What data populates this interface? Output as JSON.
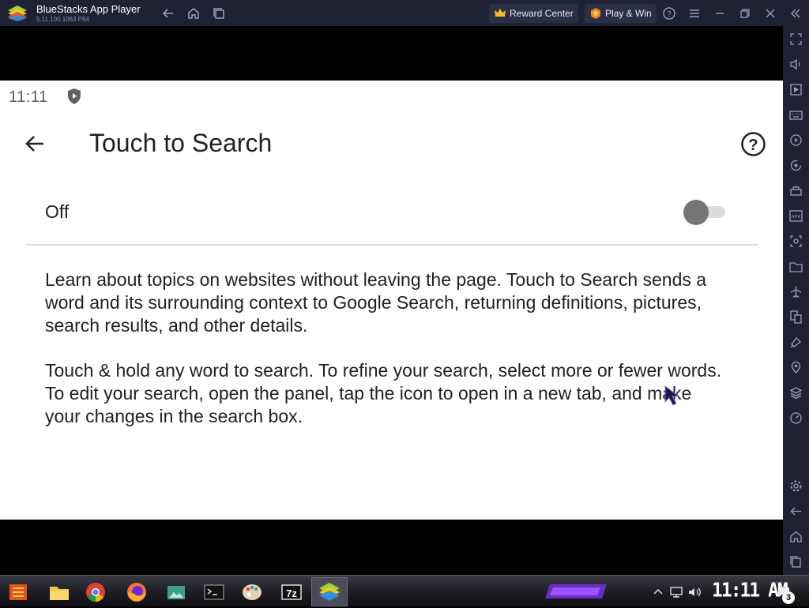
{
  "window": {
    "app_title": "BlueStacks App Player",
    "version": "5.11.100.1063 P64",
    "reward_center_label": "Reward Center",
    "play_win_label": "Play & Win"
  },
  "status_bar": {
    "time": "11:11"
  },
  "settings_page": {
    "title": "Touch to Search",
    "toggle_label": "Off",
    "toggle_on": false,
    "description_1": "Learn about topics on websites without leaving the page. Touch to Search sends a word and its surrounding context to Google Search, returning definitions, pictures, search results, and other details.",
    "description_2": "Touch & hold any word to search. To refine your search, select more or fewer words. To edit your search, open the panel, tap the icon to open in a new tab, and make your changes in the search box."
  },
  "taskbar": {
    "clock": "11:11 AM",
    "notification_count": "3",
    "archive_label": "7z"
  },
  "colors": {
    "titlebar": "#1f2235",
    "sidebar": "#1f2235",
    "screen_bg": "#ffffff",
    "toggle_thumb_off": "#757575"
  },
  "sidebar_icons": [
    "fullscreen-icon",
    "volume-icon",
    "media-manager-icon",
    "keyboard-icon",
    "macro-icon",
    "rotate-icon",
    "game-controls-icon",
    "apk-install-icon",
    "screenshot-icon",
    "folder-icon",
    "airplane-icon",
    "multi-instance-icon",
    "eco-mode-icon",
    "location-icon",
    "layers-icon",
    "performance-icon",
    "settings-icon",
    "back-icon",
    "home-icon",
    "recents-icon"
  ]
}
